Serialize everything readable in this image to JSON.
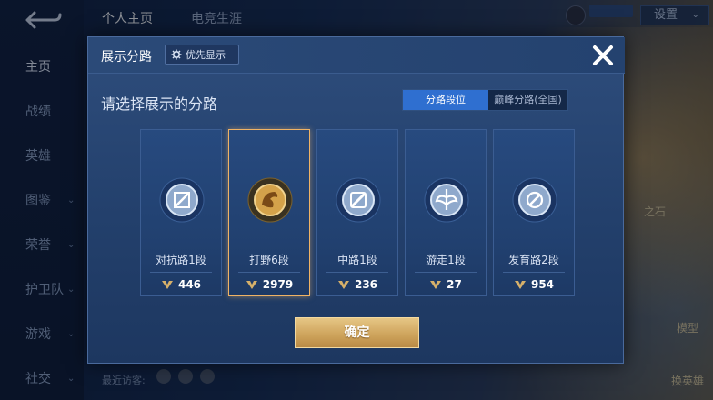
{
  "background": {
    "sidebar": {
      "items": [
        {
          "label": "主页",
          "active": true
        },
        {
          "label": "战绩",
          "active": false
        },
        {
          "label": "英雄",
          "active": false
        },
        {
          "label": "图鉴",
          "active": false
        },
        {
          "label": "荣誉",
          "active": false
        },
        {
          "label": "护卫队",
          "active": false
        },
        {
          "label": "游戏",
          "active": false
        },
        {
          "label": "社交",
          "active": false
        }
      ]
    },
    "tabs": [
      {
        "label": "个人主页",
        "active": true
      },
      {
        "label": "电竞生涯",
        "active": false
      }
    ],
    "settings_label": "设置",
    "right_labels": [
      "之石",
      "模型",
      "换英雄"
    ],
    "visitor_text": "最近访客:"
  },
  "modal": {
    "title": "展示分路",
    "priority_label": "优先显示",
    "prompt": "请选择展示的分路",
    "segments": [
      {
        "label": "分路段位",
        "active": true
      },
      {
        "label": "巅峰分路(全国)",
        "active": false
      }
    ],
    "cards": [
      {
        "label": "对抗路1段",
        "score": "446",
        "selected": false,
        "emblem": "clash-lane-emblem-icon"
      },
      {
        "label": "打野6段",
        "score": "2979",
        "selected": true,
        "emblem": "jungle-emblem-icon"
      },
      {
        "label": "中路1段",
        "score": "236",
        "selected": false,
        "emblem": "mid-lane-emblem-icon"
      },
      {
        "label": "游走1段",
        "score": "27",
        "selected": false,
        "emblem": "roam-emblem-icon"
      },
      {
        "label": "发育路2段",
        "score": "954",
        "selected": false,
        "emblem": "farm-lane-emblem-icon"
      }
    ],
    "confirm_label": "确定"
  },
  "colors": {
    "accent_blue": "#2f6fd0",
    "gold": "#cda25a",
    "selected_border": "#f0b365"
  }
}
